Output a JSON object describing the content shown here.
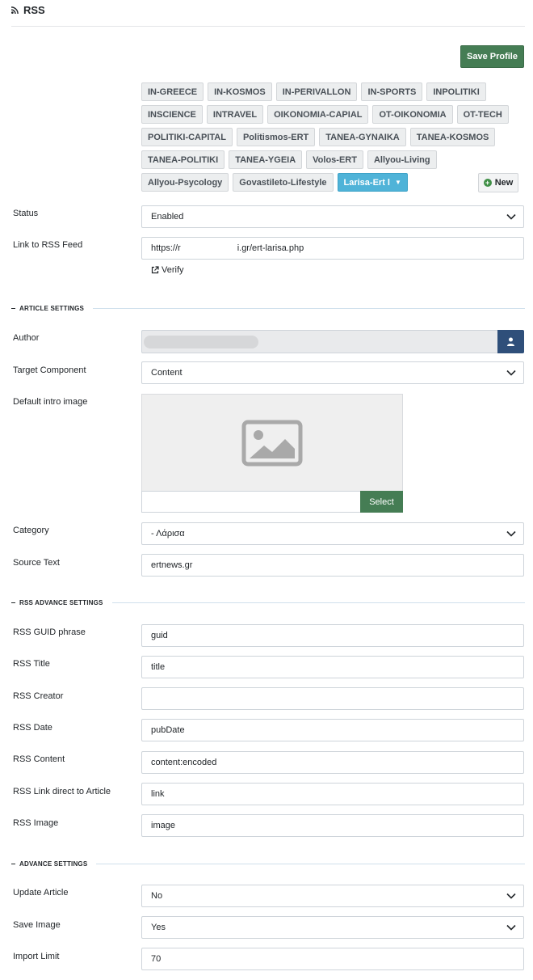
{
  "header": {
    "title": "RSS"
  },
  "toolbar": {
    "save_label": "Save Profile"
  },
  "profiles": {
    "tags": [
      "IN-GREECE",
      "IN-KOSMOS",
      "IN-PERIVALLON",
      "IN-SPORTS",
      "INPOLITIKI",
      "INSCIENCE",
      "INTRAVEL",
      "OIKONOMIA-CAPIAL",
      "OT-OIKONOMIA",
      "OT-TECH",
      "POLITIKI-CAPITAL",
      "Politismos-ERT",
      "TANEA-GYNAIKA",
      "TANEA-KOSMOS",
      "TANEA-POLITIKI",
      "TANEA-YGEIA",
      "Volos-ERT",
      "Allyou-Living",
      "Allyou-Psycology",
      "Govastileto-Lifestyle"
    ],
    "active_label": "Larisa-Ert l",
    "new_label": "New"
  },
  "status": {
    "label": "Status",
    "value": "Enabled"
  },
  "rss_link": {
    "label": "Link to RSS Feed",
    "value_start": "https://r",
    "value_end": "i.gr/ert-larisa.php",
    "verify_label": "Verify"
  },
  "article_settings": {
    "heading": "ARTICLE SETTINGS",
    "author_label": "Author",
    "target_label": "Target Component",
    "target_value": "Content",
    "intro_image_label": "Default intro image",
    "select_label": "Select",
    "category_label": "Category",
    "category_value": "- Λάρισα",
    "source_label": "Source Text",
    "source_value": "ertnews.gr"
  },
  "rss_advance": {
    "heading": "RSS ADVANCE SETTINGS",
    "fields": [
      {
        "label": "RSS GUID phrase",
        "value": "guid"
      },
      {
        "label": "RSS Title",
        "value": "title"
      },
      {
        "label": "RSS Creator",
        "value": ""
      },
      {
        "label": "RSS Date",
        "value": "pubDate"
      },
      {
        "label": "RSS Content",
        "value": "content:encoded"
      },
      {
        "label": "RSS Link direct to Article",
        "value": "link"
      },
      {
        "label": "RSS Image",
        "value": "image"
      }
    ]
  },
  "advance": {
    "heading": "ADVANCE SETTINGS",
    "update_label": "Update Article",
    "update_value": "No",
    "save_image_label": "Save Image",
    "save_image_value": "Yes",
    "import_limit_label": "Import Limit",
    "import_limit_value": "70"
  },
  "colors": {
    "save": "#457d54",
    "active_tag": "#4fb3d8",
    "author_button": "#2f4f7a"
  }
}
